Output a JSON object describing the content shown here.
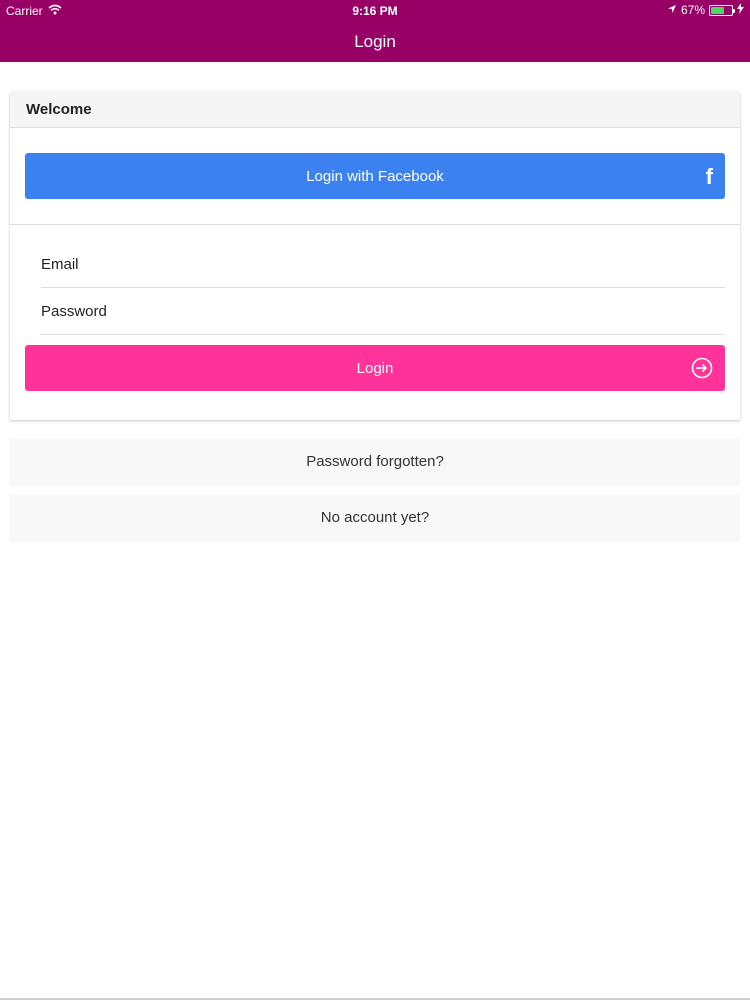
{
  "status_bar": {
    "carrier": "Carrier",
    "time": "9:16 PM",
    "battery_percent": "67%",
    "battery_level": 0.67,
    "icons": [
      "wifi-icon",
      "location-arrow-icon",
      "battery-icon",
      "charging-bolt-icon"
    ]
  },
  "nav": {
    "title": "Login"
  },
  "card": {
    "header": "Welcome",
    "facebook_button": {
      "label": "Login with Facebook",
      "icon": "f"
    },
    "email": {
      "placeholder": "Email",
      "value": ""
    },
    "password": {
      "placeholder": "Password",
      "value": ""
    },
    "login_button": {
      "label": "Login"
    }
  },
  "links": {
    "forgot": "Password forgotten?",
    "signup": "No account yet?"
  },
  "colors": {
    "header_bar": "#990066",
    "facebook": "#3b82f0",
    "login": "#ff3399"
  }
}
